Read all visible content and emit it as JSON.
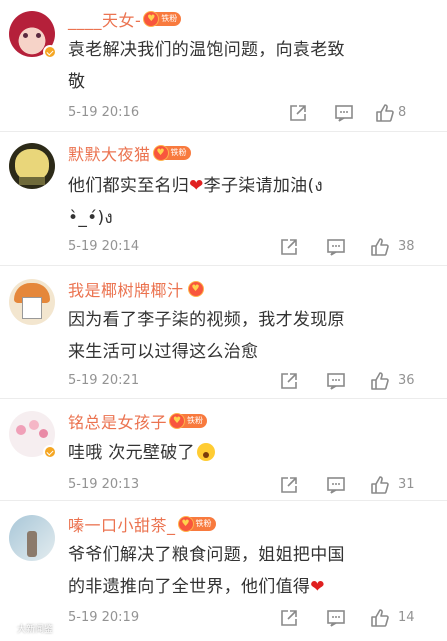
{
  "comments": [
    {
      "username": "____天女-",
      "badge": "铁粉",
      "text_lines": [
        "袁老解决我们的温饱问题，向袁老致",
        "敬"
      ],
      "time": "5-19 20:16",
      "likes": "8"
    },
    {
      "username": "默默大夜猫",
      "badge": "铁粉",
      "text_lines": [
        "他们都实至名归",
        "李子柒请加油(ง",
        "•̀_•́)ง"
      ],
      "time": "5-19 20:14",
      "likes": "38"
    },
    {
      "username": "我是椰树牌椰汁",
      "badge": "",
      "text_lines": [
        "因为看了李子柒的视频，我才发现原",
        "来生活可以过得这么治愈"
      ],
      "time": "5-19 20:21",
      "likes": "36"
    },
    {
      "username": "铭总是女孩子",
      "badge": "铁粉",
      "text_lines": [
        "哇哦 次元壁破了"
      ],
      "time": "5-19 20:13",
      "likes": "31"
    },
    {
      "username": "嗪一口小甜茶_",
      "badge": "铁粉",
      "text_lines": [
        "爷爷们解决了粮食问题，姐姐把中国",
        "的非遗推向了全世界，他们值得"
      ],
      "time": "5-19 20:19",
      "likes": "14"
    }
  ],
  "icons": {
    "share": "share-icon",
    "comment": "comment-icon",
    "like": "thumbs-up-icon"
  },
  "colors": {
    "username": "#eb7350",
    "meta": "#939393",
    "verified_badge": "#f5a623"
  },
  "watermark": "大新闻鉴"
}
